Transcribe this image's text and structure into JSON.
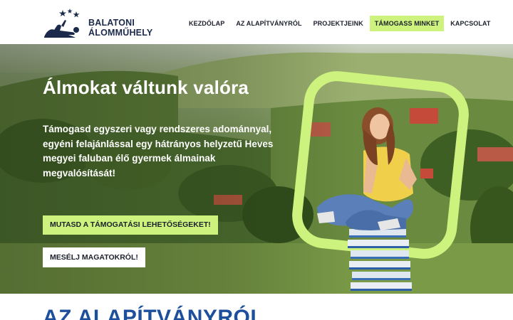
{
  "brand": {
    "line1": "BALATONI",
    "line2": "ÁLOMMŰHELY",
    "logo_icon": "person-lying-stars-icon",
    "color": "#1b2a4a"
  },
  "nav": {
    "items": [
      {
        "label": "KEZDŐLAP"
      },
      {
        "label": "AZ ALAPÍTVÁNYRÓL"
      },
      {
        "label": "PROJEKTJEINK"
      },
      {
        "label": "TÁMOGASS MINKET"
      },
      {
        "label": "KAPCSOLAT"
      }
    ],
    "active_index": 3,
    "active_color": "#cdf37e"
  },
  "hero": {
    "title": "Álmokat váltunk valóra",
    "text": "Támogasd egyszeri vagy rendszeres adománnyal, egyéni felajánlással egy hátrányos helyzetű Heves megyei faluban élő gyermek álmainak megvalósítását!",
    "primary_button": "MUTASD A TÁMOGATÁSI LEHETŐSÉGEKET!",
    "secondary_button": "MESÉLJ MAGATOKRÓL!",
    "accent_color": "#cdf37e"
  },
  "section": {
    "title": "AZ ALAPÍTVÁNYRÓL",
    "color": "#1e4f9c"
  }
}
